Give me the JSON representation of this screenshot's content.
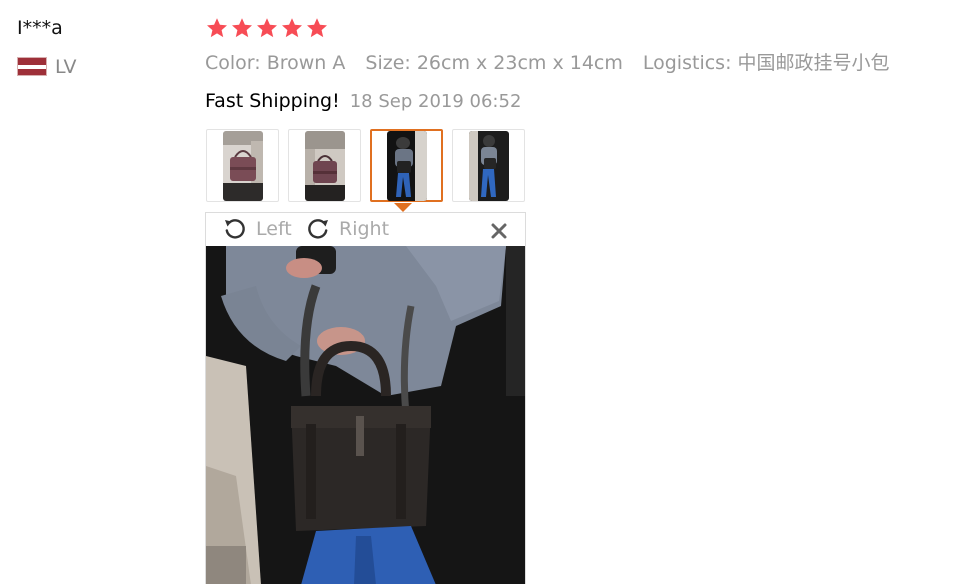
{
  "reviewer": {
    "name": "I***a",
    "country_code": "LV",
    "flag_icon": "latvia-flag-icon",
    "flag_colors": [
      "#9e3039",
      "#ffffff"
    ]
  },
  "review": {
    "rating": 5,
    "rating_max": 5,
    "star_color": "#f74c55",
    "color_option": "Color: Brown A",
    "size_option": "Size: 26cm x 23cm x 14cm",
    "logistics": "Logistics: 中国邮政挂号小包",
    "feedback": "Fast Shipping!",
    "date": "18 Sep 2019 06:52"
  },
  "thumbnails": [
    {
      "name": "review-photo-thumbnail-1",
      "active": false
    },
    {
      "name": "review-photo-thumbnail-2",
      "active": false
    },
    {
      "name": "review-photo-thumbnail-3",
      "active": true
    },
    {
      "name": "review-photo-thumbnail-4",
      "active": false
    }
  ],
  "viewer": {
    "rotate_left_label": "Left",
    "rotate_right_label": "Right",
    "rotate_left_icon": "rotate-left-icon",
    "rotate_right_icon": "rotate-right-icon",
    "close_icon": "close-icon",
    "accent_color": "#e07020"
  }
}
